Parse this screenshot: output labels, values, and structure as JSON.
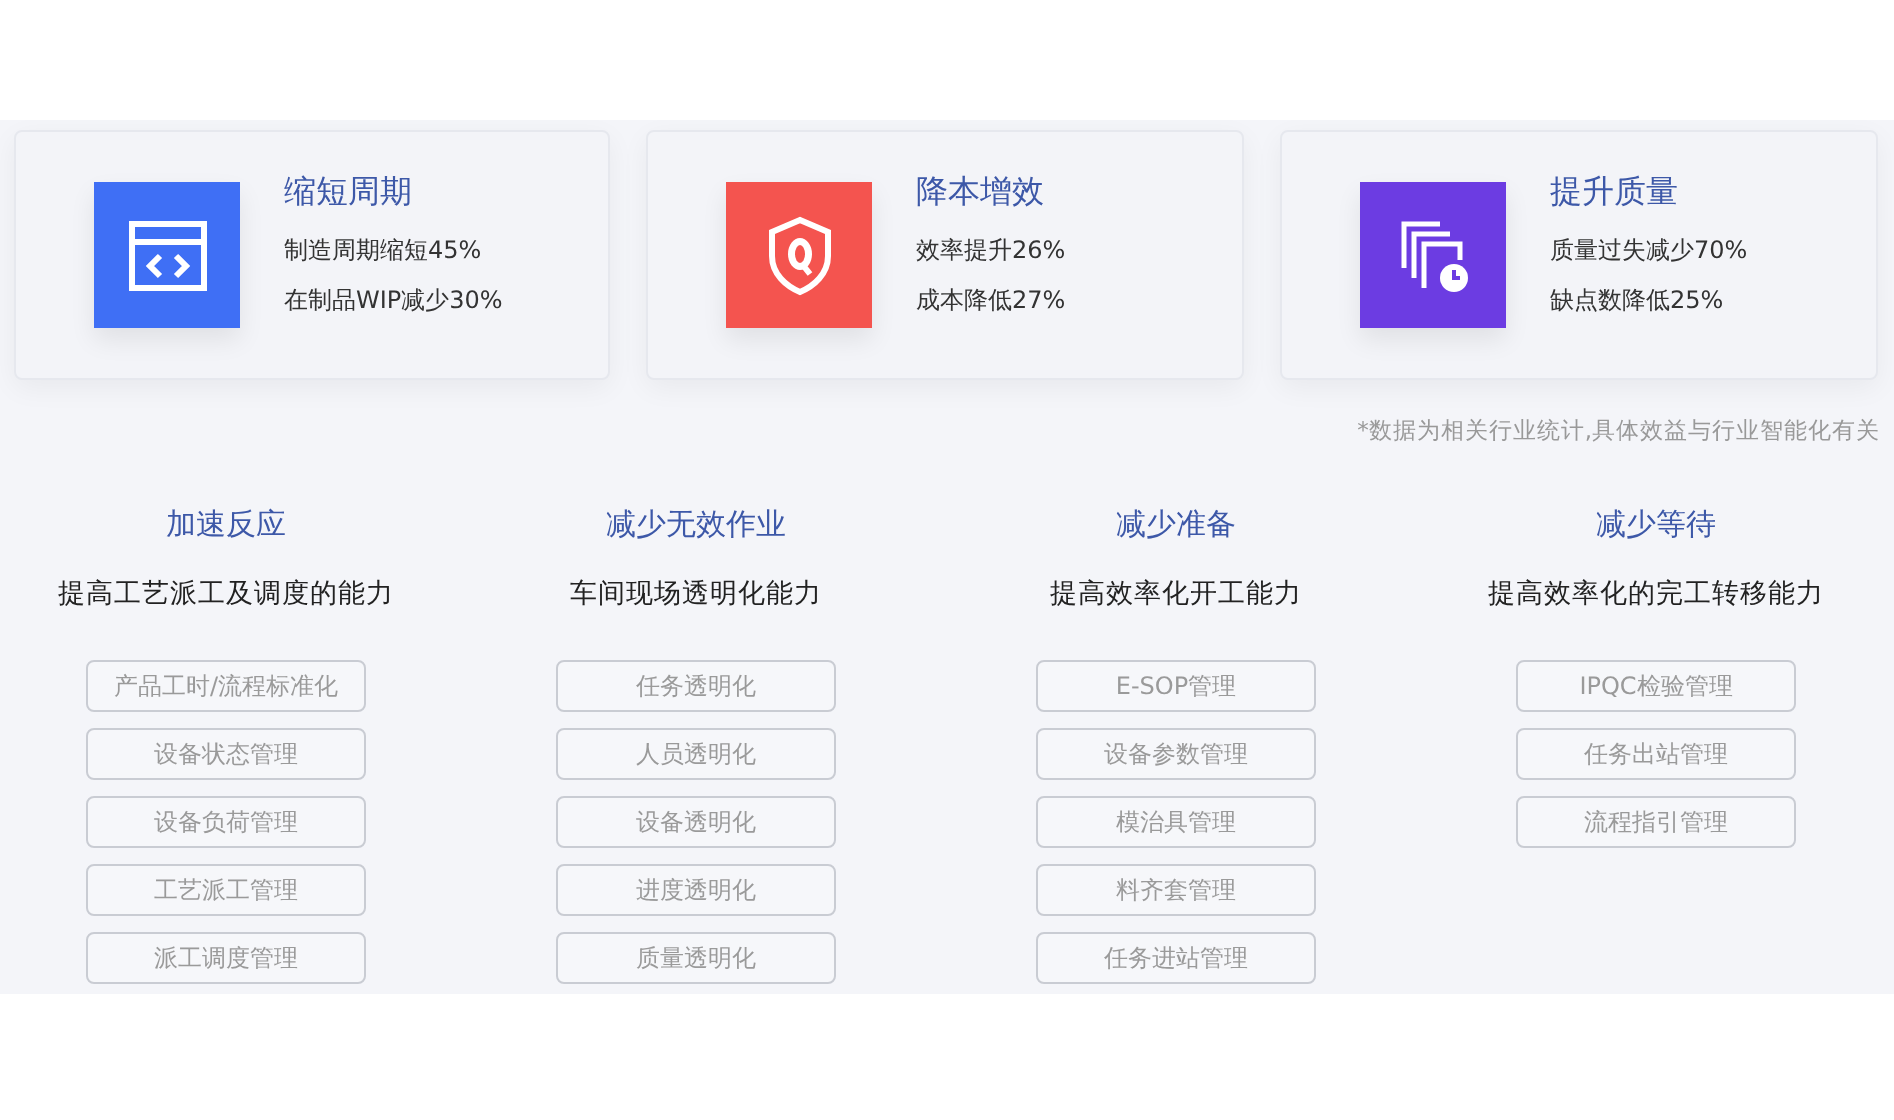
{
  "cards": [
    {
      "kind": "code",
      "color": "#3f6ff5",
      "title": "缩短周期",
      "lines": [
        "制造周期缩短45%",
        "在制品WIP减少30%"
      ]
    },
    {
      "kind": "shield",
      "color": "#f4544f",
      "title": "降本增效",
      "lines": [
        "效率提升26%",
        "成本降低27%"
      ]
    },
    {
      "kind": "pages",
      "color": "#6c3ce2",
      "title": "提升质量",
      "lines": [
        "质量过失减少70%",
        "缺点数降低25%"
      ]
    }
  ],
  "note": "*数据为相关行业统计,具体效益与行业智能化有关",
  "columns": [
    {
      "title": "加速反应",
      "subtitle": "提高工艺派工及调度的能力",
      "tags": [
        "产品工时/流程标准化",
        "设备状态管理",
        "设备负荷管理",
        "工艺派工管理",
        "派工调度管理"
      ]
    },
    {
      "title": "减少无效作业",
      "subtitle": "车间现场透明化能力",
      "tags": [
        "任务透明化",
        "人员透明化",
        "设备透明化",
        "进度透明化",
        "质量透明化"
      ]
    },
    {
      "title": "减少准备",
      "subtitle": "提高效率化开工能力",
      "tags": [
        "E-SOP管理",
        "设备参数管理",
        "模治具管理",
        "料齐套管理",
        "任务进站管理"
      ]
    },
    {
      "title": "减少等待",
      "subtitle": "提高效率化的完工转移能力",
      "tags": [
        "IPQC检验管理",
        "任务出站管理",
        "流程指引管理"
      ]
    }
  ]
}
